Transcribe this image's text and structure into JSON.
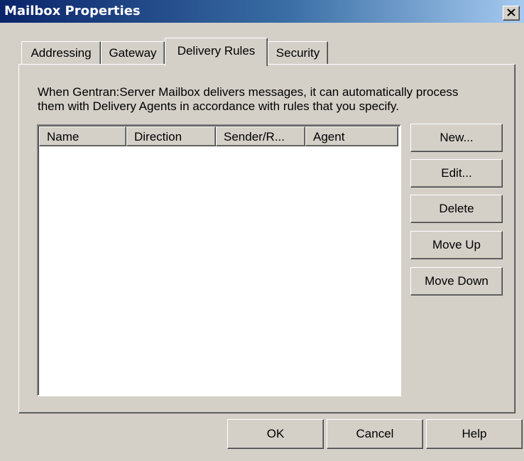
{
  "window": {
    "title": "Mailbox Properties",
    "close_glyph": "✕"
  },
  "tabs": [
    {
      "label": "Addressing",
      "active": false
    },
    {
      "label": "Gateway",
      "active": false
    },
    {
      "label": "Delivery Rules",
      "active": true
    },
    {
      "label": "Security",
      "active": false
    }
  ],
  "panel": {
    "description_line1": "When Gentran:Server Mailbox delivers messages, it can automatically process",
    "description_line2": "them with Delivery Agents in accordance with rules that you specify."
  },
  "rules_list": {
    "columns": [
      "Name",
      "Direction",
      "Sender/R...",
      "Agent"
    ],
    "rows": []
  },
  "side_buttons": {
    "new": "New...",
    "edit": "Edit...",
    "delete": "Delete",
    "move_up": "Move Up",
    "move_down": "Move Down"
  },
  "dialog_buttons": {
    "ok": "OK",
    "cancel": "Cancel",
    "help": "Help"
  },
  "colors": {
    "titlebar_start": "#0a246a",
    "titlebar_end": "#a6caf0",
    "face": "#d4d0c8"
  }
}
